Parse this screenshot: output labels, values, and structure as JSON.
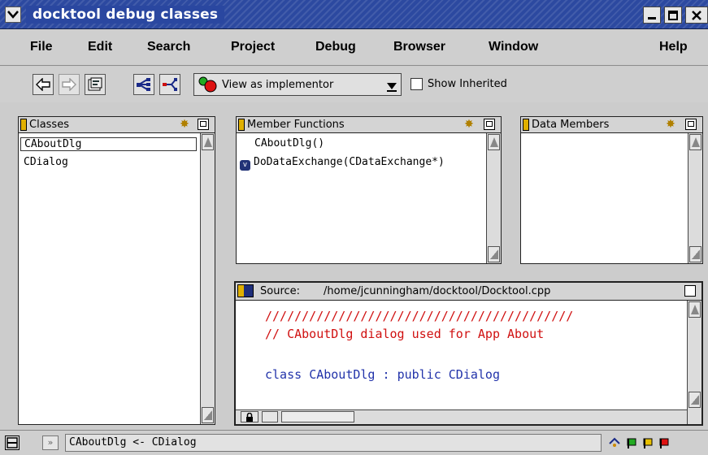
{
  "window": {
    "title": "docktool debug classes"
  },
  "menubar": [
    "File",
    "Edit",
    "Search",
    "Project",
    "Debug",
    "Browser",
    "Window",
    "Help"
  ],
  "toolbar": {
    "view_dropdown": "View as implementor",
    "show_inherited": "Show Inherited"
  },
  "panes": {
    "classes": {
      "title": "Classes",
      "items": [
        "CAboutDlg",
        "CDialog"
      ]
    },
    "member_functions": {
      "title": "Member Functions",
      "items": [
        "CAboutDlg()",
        "DoDataExchange(CDataExchange*)"
      ]
    },
    "data_members": {
      "title": "Data Members"
    },
    "source": {
      "label": "Source:",
      "path": "/home/jcunningham/docktool/Docktool.cpp",
      "lines": {
        "l1": "//////////////////////////////////////////",
        "l2": "// CAboutDlg dialog used for App About",
        "l4_kw1": "class",
        "l4_name": "CAboutDlg",
        "l4_colon": ":",
        "l4_kw2": "public",
        "l4_base": "CDialog"
      }
    }
  },
  "status": {
    "text": "CAboutDlg <- CDialog"
  },
  "colors": {
    "titlebar": "#2c49a0",
    "comment": "#d01010",
    "code_kw": "#2233aa"
  }
}
